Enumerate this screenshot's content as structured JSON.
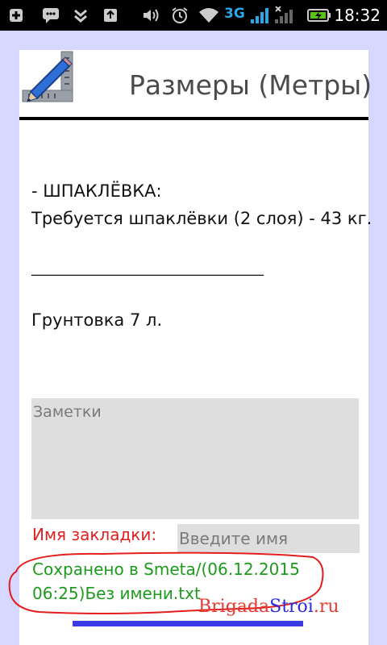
{
  "status_bar": {
    "network_label": "3G",
    "time": "18:32",
    "icons": [
      "plus-square-icon",
      "chat-icon",
      "chevrons-down-icon",
      "volume-icon",
      "alarm-icon",
      "wifi-icon",
      "signal-icon",
      "no-signal-icon",
      "battery-charging-icon"
    ]
  },
  "header": {
    "title": "Размеры (Метры)",
    "logo": "pencil-ruler-icon"
  },
  "content": {
    "section_title": "- ШПАКЛЁВКА:",
    "putty_line": " Требуется шпаклёвки (2 слоя) - 43 кг.",
    "separator": "________________________________",
    "primer_line": " Грунтовка  7 л."
  },
  "notes": {
    "placeholder": "Заметки"
  },
  "bookmark": {
    "label": "Имя закладки:",
    "placeholder": "Введите имя"
  },
  "saved_message": {
    "line1": "Сохранено в Smeta/(06.12.2015",
    "line2": "06:25)Без имени.txt"
  },
  "watermark": {
    "part1": "Brigada",
    "part2": "Stroi",
    "part3": ".ru"
  },
  "colors": {
    "accent_red": "#e02020",
    "saved_green": "#1d9a1d",
    "background": "#d6d8ff"
  }
}
